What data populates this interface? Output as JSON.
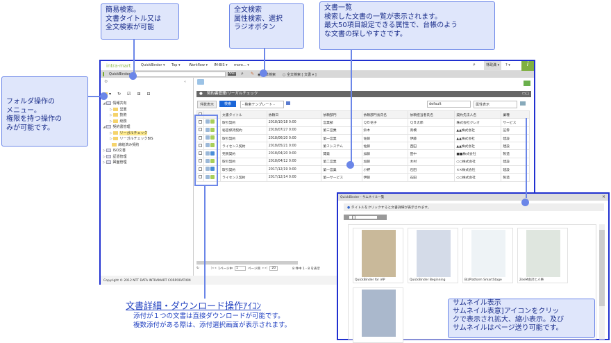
{
  "nav": {
    "logo": "intra-mart",
    "menus": [
      "QuickBinder ▾",
      "Top ▾",
      "Workflow ▾",
      "IM-BIS ▾",
      "more... ▾"
    ],
    "user": "林政満 ▾",
    "help": "? ▾"
  },
  "search": {
    "app_label": "QuickBinder",
    "and_label": "AND",
    "radio_standard": "標準検索",
    "radio_fulltext": "全文検索 [ 文書 ▾ ]"
  },
  "tree": [
    {
      "label": "情報共有",
      "level": 0
    },
    {
      "label": "営業",
      "level": 1
    },
    {
      "label": "技術",
      "level": 1
    },
    {
      "label": "総務",
      "level": 1
    },
    {
      "label": "契約書管理",
      "level": 0
    },
    {
      "label": "リーガルチェック",
      "level": 1,
      "selected": true
    },
    {
      "label": "リーガルチェックBIS",
      "level": 1
    },
    {
      "label": "締結済み契約",
      "level": 1
    },
    {
      "label": "ISO文書",
      "level": 0
    },
    {
      "label": "証憑管理",
      "level": 0
    },
    {
      "label": "図面管理",
      "level": 0
    }
  ],
  "panel": {
    "title": "契約書管理/リーガルチェック",
    "count_button": "件数表示",
    "search_button": "検索",
    "template_select": "- 検索テンプレート -",
    "view_select": "default",
    "attr_select": "属性表示"
  },
  "table": {
    "headers": [
      "文書タイトル",
      "依頼日",
      "依頼部門",
      "依頼部門長氏名",
      "依頼担当者氏名",
      "契約先法人名",
      "業種"
    ],
    "rows": [
      [
        "取引契約",
        "2018/10/18 0:00",
        "営業部",
        "ＱＢ花子",
        "ＱＢ太郎",
        "株式会社クレオ",
        "サービス"
      ],
      [
        "秘密保持契約",
        "2018/07/27 0:00",
        "第三営業",
        "鈴木",
        "高橋",
        "▲▲株式会社",
        "証券"
      ],
      [
        "取引契約",
        "2018/06/20 0:00",
        "第一営業",
        "佐藤",
        "伊藤",
        "▲▲株式会社",
        "建設"
      ],
      [
        "ライセンス契約",
        "2018/05/21 0:00",
        "第２システム",
        "佐藤",
        "西田",
        "▲▲株式会社",
        "建設"
      ],
      [
        "売買契約",
        "2018/04/20 0:00",
        "開発",
        "加藤",
        "田中",
        "■■株式会社",
        "製造"
      ],
      [
        "取引契約",
        "2018/04/12 0:00",
        "第二営業",
        "加藤",
        "木村",
        "○○株式会社",
        "建設"
      ],
      [
        "取引契約",
        "2017/12/19 0:00",
        "第一営業",
        "小野",
        "石田",
        "××株式会社",
        "建設"
      ],
      [
        "ライセンス契約",
        "2017/12/14 0:00",
        "第一サービス",
        "伊藤",
        "石田",
        "○○株式会社",
        "製造"
      ]
    ]
  },
  "pager": {
    "of_pages": "1ページ中",
    "page": "1",
    "page_suffix": "ページ目",
    "per_page": "20",
    "summary": "8 件中 1 - 8 を表示"
  },
  "footer": "Copyright © 2012 NTT DATA INTRAMART CORPORATION",
  "dialog": {
    "title": "QuickBinder - サムネイル一覧",
    "info": "タイトルをクリックすると文書詳細が表示されます。",
    "thumbs": [
      "QuickBinder for iAP",
      "QuickBinder Beginning",
      "BizPlatform SmartStage",
      "ZeeM会計と人事",
      ""
    ]
  },
  "callouts": {
    "simple_search": "簡易検索。\n文書タイトル又は\n全文検索が可能",
    "fulltext": "全文検索\n属性検索、選択\nラジオボタン",
    "doc_list": "文書一覧\n検索した文書の一覧が表示されます。\n最大50項目設定できる属性で、台帳のよう\nな文書の探しやすさです。",
    "folder": "フォルダ操作の\nメニュー。\n権限を持つ操作の\nみが可能です。",
    "thumbnail": "サムネイル表示\nサムネイル表意]アイコンをクリッ\nクで表示され拡大、縮小表示。及び\nサムネイルはページ送り可能です。",
    "icons_title": "文書詳細・ダウンロード操作ｱｲｺﾝ",
    "icons_desc": "添付が１つの文書は直接ダウンロードが可能です。\n複数添付がある際は、添付選択画面が表示されます。"
  }
}
